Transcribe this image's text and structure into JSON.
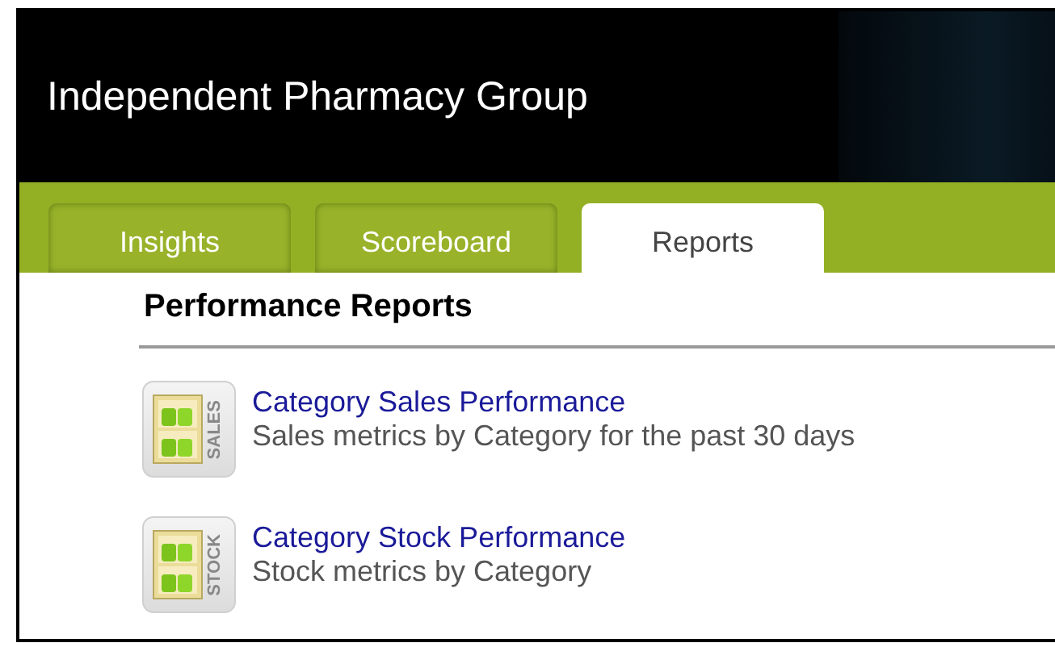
{
  "header": {
    "title": "Independent Pharmacy Group"
  },
  "tabs": [
    {
      "label": "Insights",
      "selected": false
    },
    {
      "label": "Scoreboard",
      "selected": false
    },
    {
      "label": "Reports",
      "selected": true
    }
  ],
  "section": {
    "title": "Performance Reports"
  },
  "reports": [
    {
      "icon_label": "SALES",
      "title": "Category Sales Performance",
      "description": "Sales metrics by Category for the past 30 days"
    },
    {
      "icon_label": "STOCK",
      "title": "Category Stock Performance",
      "description": "Stock metrics by Category"
    }
  ]
}
